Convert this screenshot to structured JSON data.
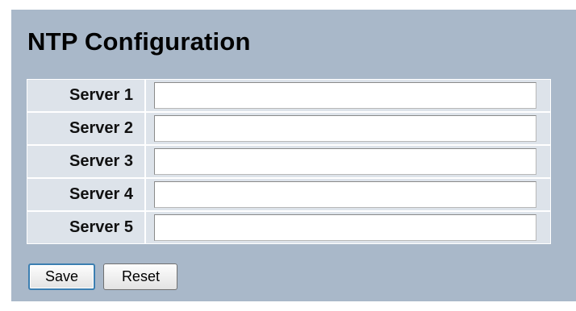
{
  "page": {
    "title": "NTP Configuration"
  },
  "servers": [
    {
      "label": "Server 1",
      "value": ""
    },
    {
      "label": "Server 2",
      "value": ""
    },
    {
      "label": "Server 3",
      "value": ""
    },
    {
      "label": "Server 4",
      "value": ""
    },
    {
      "label": "Server 5",
      "value": ""
    }
  ],
  "actions": {
    "save_label": "Save",
    "reset_label": "Reset"
  },
  "colors": {
    "panel_background": "#a9b8c9",
    "row_background": "#dde3ea",
    "focus_border": "#3c7fb1"
  }
}
